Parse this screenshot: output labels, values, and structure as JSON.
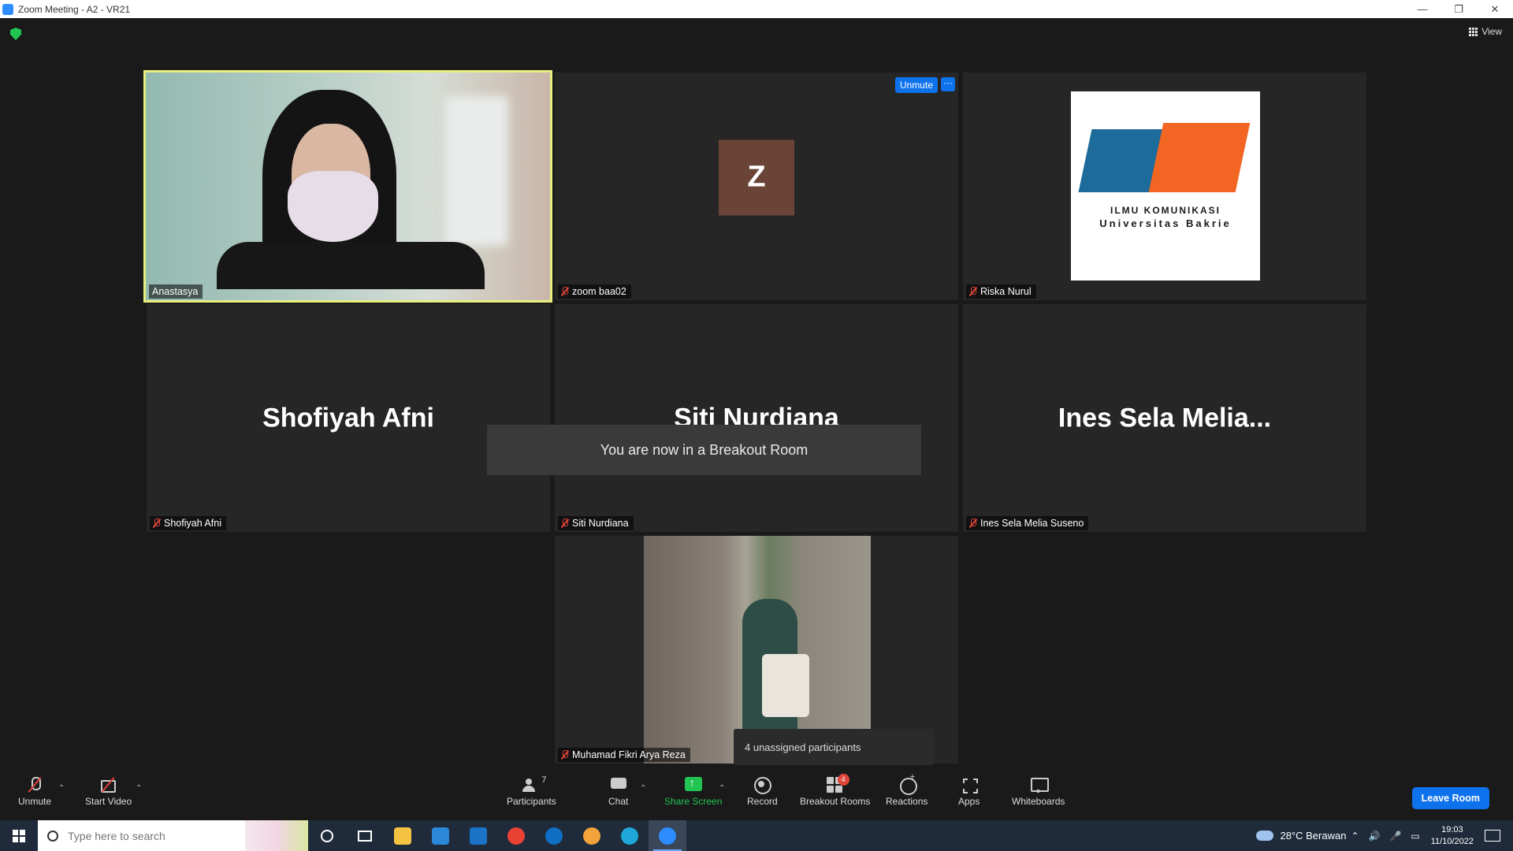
{
  "window": {
    "title": "Zoom Meeting - A2 - VR21",
    "minimize": "—",
    "restore": "❐",
    "close": "✕"
  },
  "top": {
    "view_label": "View"
  },
  "tiles": [
    {
      "name": "Anastasya"
    },
    {
      "name": "zoom baa02",
      "avatar_letter": "Z",
      "unmute": "Unmute",
      "more": "···"
    },
    {
      "name": "Riska Nurul",
      "logo_line1": "ILMU KOMUNIKASI",
      "logo_line2": "Universitas Bakrie"
    },
    {
      "name": "Shofiyah Afni",
      "display": "Shofiyah Afni"
    },
    {
      "name": "Siti Nurdiana",
      "display": "Siti Nurdiana"
    },
    {
      "name": "Ines Sela Melia Suseno",
      "display": "Ines Sela Melia..."
    },
    {
      "name": "Muhamad Fikri Arya Reza"
    }
  ],
  "toast": "You are now in a Breakout Room",
  "tooltip": "4 unassigned participants",
  "toolbar": {
    "unmute": "Unmute",
    "start_video": "Start Video",
    "participants": "Participants",
    "participants_count": "7",
    "chat": "Chat",
    "share": "Share Screen",
    "record": "Record",
    "breakout": "Breakout Rooms",
    "breakout_badge": "4",
    "reactions": "Reactions",
    "apps": "Apps",
    "whiteboards": "Whiteboards",
    "leave": "Leave Room"
  },
  "taskbar": {
    "search_placeholder": "Type here to search",
    "weather": "28°C  Berawan",
    "time": "19:03",
    "date": "11/10/2022"
  },
  "colors": {
    "accent": "#0e72ed",
    "active_speaker": "#e8ef7d",
    "muted": "#e0463c",
    "share": "#23c552"
  }
}
